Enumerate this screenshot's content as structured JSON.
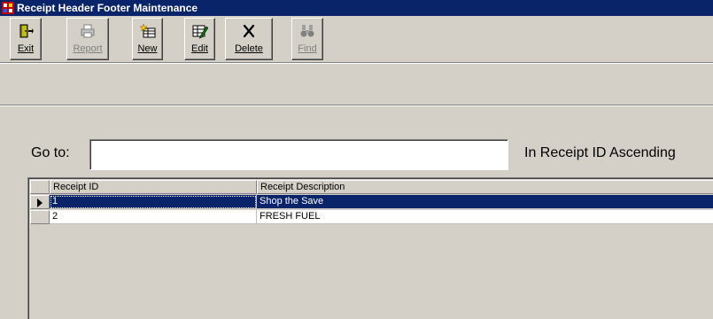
{
  "window": {
    "title": "Receipt Header Footer Maintenance",
    "icon": "app-icon"
  },
  "toolbar": {
    "buttons": [
      {
        "label": "Exit",
        "icon": "exit-door-icon",
        "enabled": true
      },
      {
        "label": "Report",
        "icon": "printer-icon",
        "enabled": false
      },
      {
        "label": "New",
        "icon": "new-record-icon",
        "enabled": true
      },
      {
        "label": "Edit",
        "icon": "edit-record-icon",
        "enabled": true
      },
      {
        "label": "Delete",
        "icon": "delete-x-icon",
        "enabled": true
      },
      {
        "label": "Find",
        "icon": "binoculars-icon",
        "enabled": false
      }
    ]
  },
  "search": {
    "goto_label": "Go to:",
    "value": "",
    "sort_label": "In Receipt ID Ascending"
  },
  "grid": {
    "columns": [
      "Receipt ID",
      "Receipt Description"
    ],
    "rows": [
      {
        "id": "1",
        "description": "Shop the Save",
        "selected": true
      },
      {
        "id": "2",
        "description": "FRESH FUEL",
        "selected": false
      }
    ]
  },
  "colors": {
    "titlebar": "#0a246a",
    "face": "#d4d0c8",
    "selection": "#0a246a"
  }
}
